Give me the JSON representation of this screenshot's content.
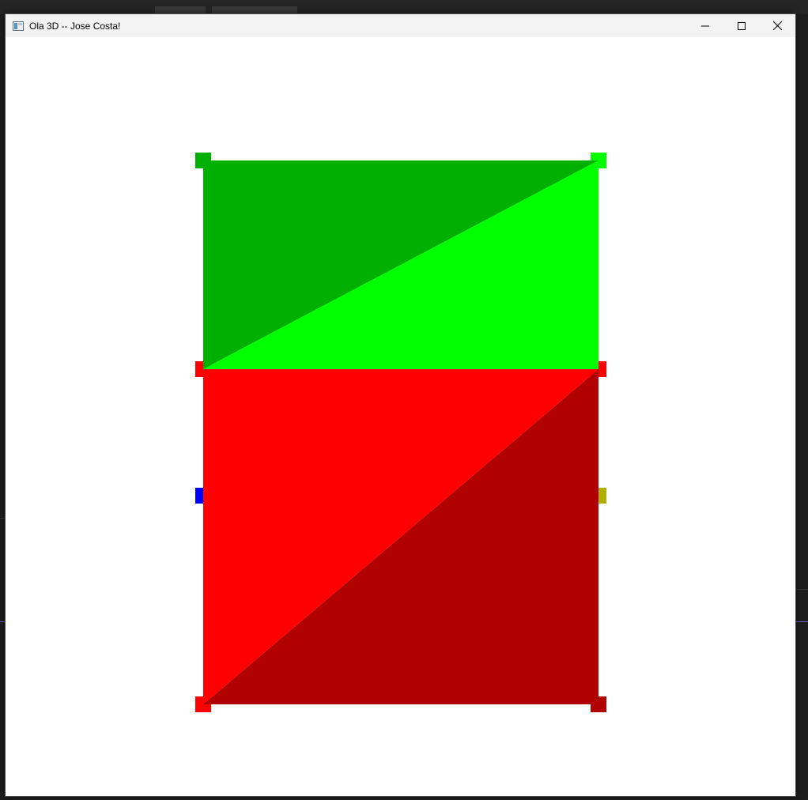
{
  "window": {
    "title": "Ola 3D -- Jose Costa!",
    "controls": [
      "minimize",
      "maximize",
      "close"
    ]
  },
  "scene": {
    "background_color": "#ffffff",
    "quads": [
      {
        "name": "green-quad",
        "triangles": [
          {
            "name": "green-upper-left-triangle",
            "color": "#00b000"
          },
          {
            "name": "green-lower-right-triangle",
            "color": "#00ff00"
          }
        ]
      },
      {
        "name": "red-quad",
        "triangles": [
          {
            "name": "red-upper-left-triangle",
            "color": "#ff0000"
          },
          {
            "name": "red-lower-right-triangle",
            "color": "#b00000"
          }
        ]
      }
    ],
    "vertex_markers": [
      {
        "name": "vertex-marker-top-left",
        "color": "#00b000"
      },
      {
        "name": "vertex-marker-top-right",
        "color": "#00ff00"
      },
      {
        "name": "vertex-marker-mid-left",
        "color": "#ff0000"
      },
      {
        "name": "vertex-marker-mid-right",
        "color": "#ff0000"
      },
      {
        "name": "vertex-marker-side-left",
        "color": "#0000ff"
      },
      {
        "name": "vertex-marker-side-right",
        "color": "#b0b000"
      },
      {
        "name": "vertex-marker-bottom-left",
        "color": "#ff0000"
      },
      {
        "name": "vertex-marker-bottom-right",
        "color": "#b00000"
      }
    ]
  }
}
